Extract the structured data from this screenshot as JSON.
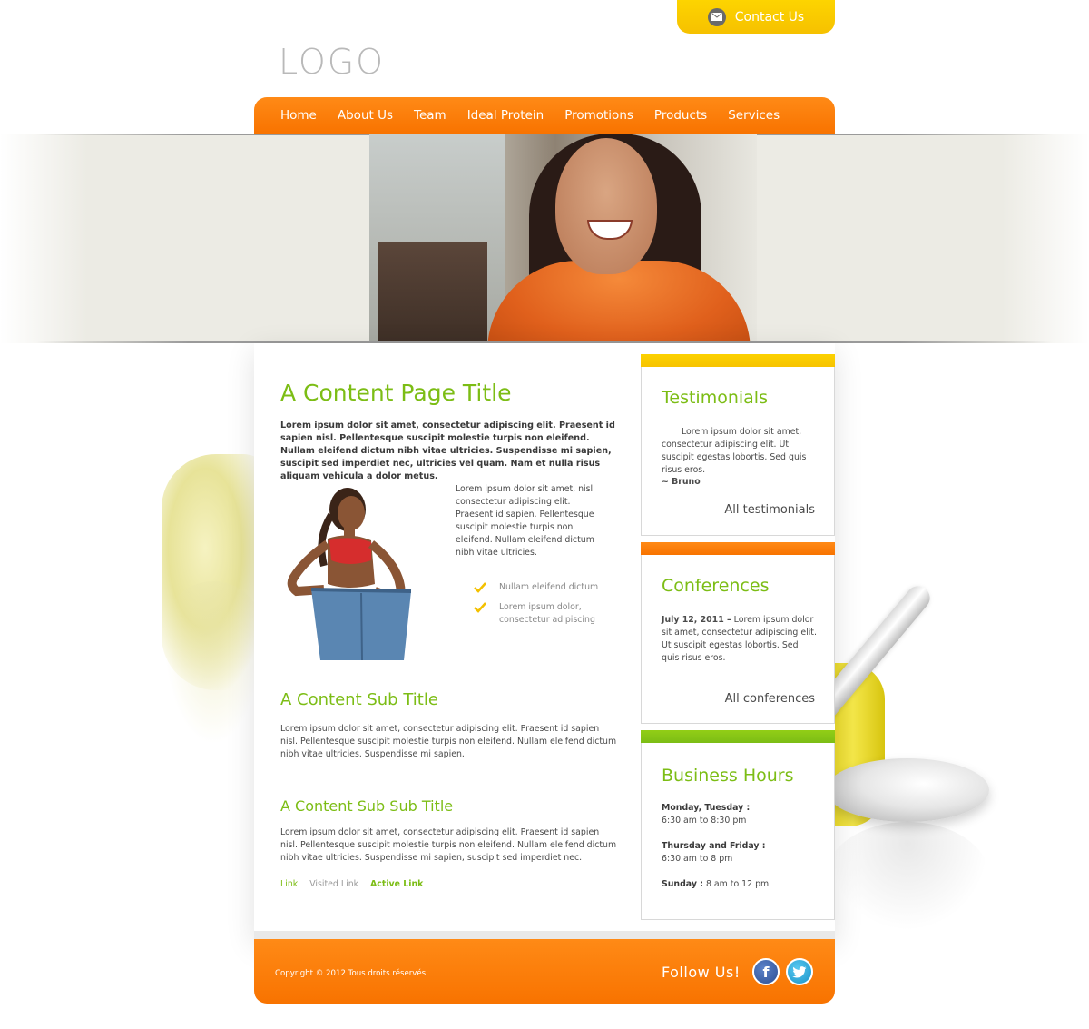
{
  "header": {
    "contact_label": "Contact Us",
    "logo_text": "LOGO"
  },
  "nav": {
    "items": [
      {
        "label": "Home"
      },
      {
        "label": "About Us"
      },
      {
        "label": "Team"
      },
      {
        "label": "Ideal Protein"
      },
      {
        "label": "Promotions"
      },
      {
        "label": "Products"
      },
      {
        "label": "Services"
      }
    ]
  },
  "main": {
    "title": "A Content Page Title",
    "intro": "Lorem ipsum dolor sit amet, consectetur adipiscing elit. Praesent id sapien nisl. Pellentesque suscipit molestie turpis non eleifend. Nullam eleifend dictum nibh vitae ultricies. Suspendisse mi sapien, suscipit sed imperdiet nec, ultricies vel quam. Nam et nulla risus aliquam vehicula a dolor metus.",
    "side_text": "Lorem ipsum dolor sit amet, nisl consectetur adipiscing elit. Praesent id sapien. Pellentesque suscipit molestie turpis non eleifend. Nullam eleifend dictum nibh vitae ultricies.",
    "checklist": [
      "Nullam eleifend dictum",
      "Lorem ipsum dolor, consectetur adipiscing"
    ],
    "sub_title": "A Content Sub Title",
    "sub_text": "Lorem ipsum dolor sit amet, consectetur adipiscing elit. Praesent id sapien nisl. Pellentesque suscipit molestie turpis non eleifend. Nullam eleifend dictum nibh vitae ultricies. Suspendisse mi sapien.",
    "subsub_title": "A Content Sub Sub Title",
    "subsub_text": "Lorem ipsum dolor sit amet, consectetur adipiscing elit. Praesent id sapien nisl. Pellentesque suscipit molestie turpis non eleifend. Nullam eleifend dictum nibh vitae ultricies. Suspendisse mi sapien, suscipit sed imperdiet nec.",
    "links": {
      "link": "Link",
      "visited": "Visited Link",
      "active": "Active Link"
    }
  },
  "sidebar": {
    "testimonials": {
      "title": "Testimonials",
      "quote": "Lorem ipsum dolor sit amet, consectetur adipiscing elit. Ut suscipit egestas lobortis. Sed quis risus eros.",
      "author": "~ Bruno",
      "link": "All testimonials"
    },
    "conferences": {
      "title": "Conferences",
      "date": "July 12, 2011 –",
      "text": " Lorem ipsum dolor sit amet, consectetur adipiscing elit. Ut suscipit egestas lobortis. Sed quis risus eros.",
      "link": "All conferences"
    },
    "hours": {
      "title": "Business Hours",
      "rows": [
        {
          "days": "Monday, Tuesday :",
          "time": "6:30 am to 8:30 pm"
        },
        {
          "days": "Thursday and Friday :",
          "time": "6:30 am to 8 pm"
        },
        {
          "days": "Sunday :",
          "time": "8 am to 12 pm"
        }
      ]
    }
  },
  "footer": {
    "copyright": "Copyright © 2012 Tous droits réservés",
    "follow": "Follow Us!",
    "social_icons": [
      "facebook-icon",
      "twitter-icon"
    ]
  },
  "colors": {
    "orange": "#f87300",
    "yellow": "#fcd200",
    "green": "#7cbd15"
  }
}
